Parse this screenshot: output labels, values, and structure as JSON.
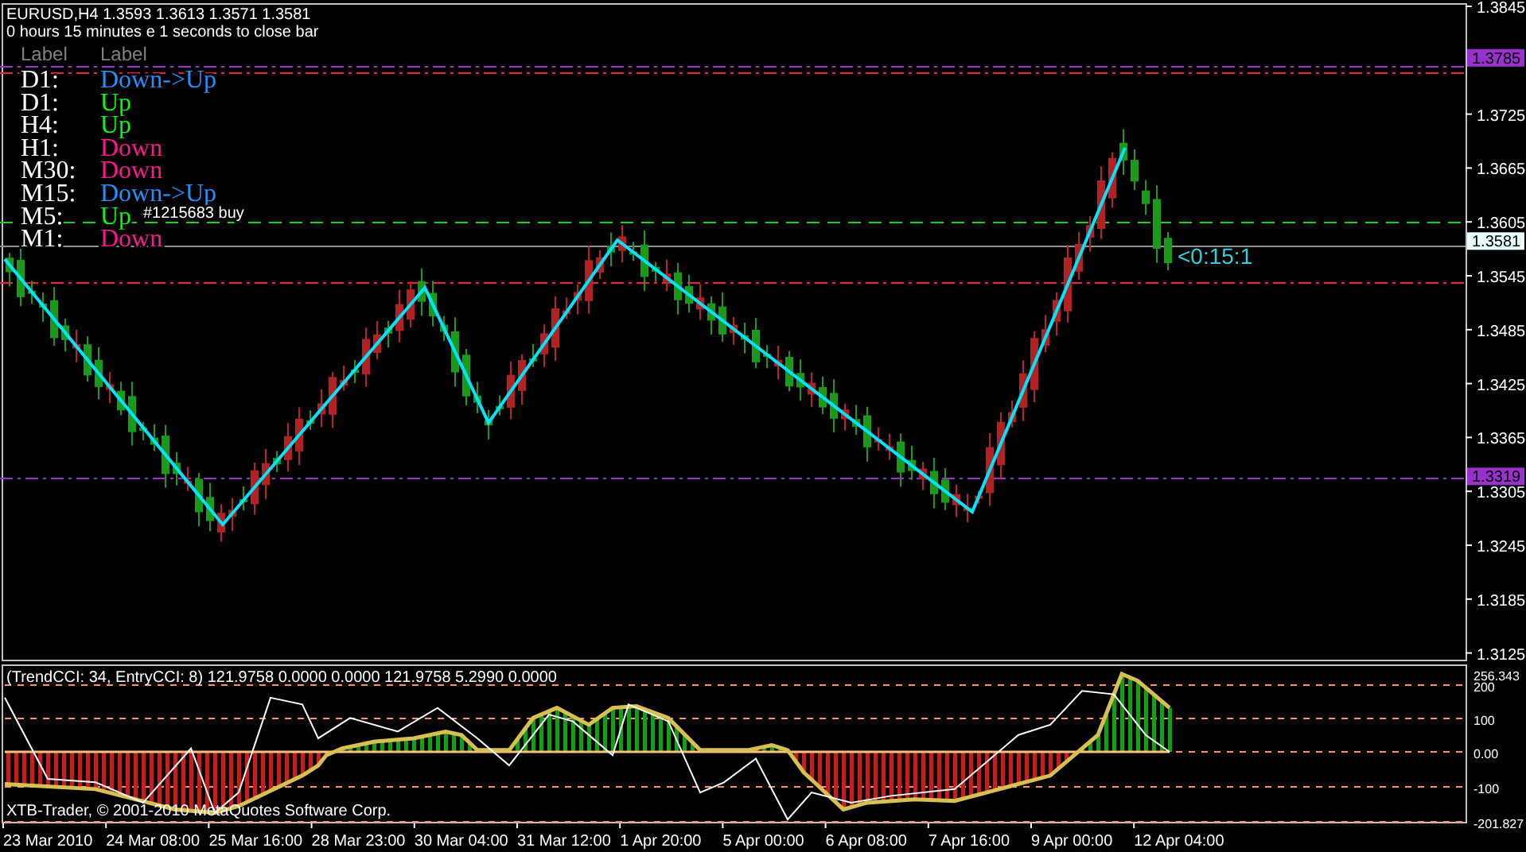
{
  "header": {
    "quote": "EURUSD,H4  1.3593 1.3613 1.3571 1.3581",
    "countdown": "0 hours 15 minutes e 1 seconds to close bar"
  },
  "labels": [
    "Label",
    "Label"
  ],
  "trend_rows": [
    {
      "timeframe": "D1:",
      "trend": "Down->Up",
      "color": "#1e90ff"
    },
    {
      "timeframe": "D1:",
      "trend": "Up",
      "color": "#00ff00"
    },
    {
      "timeframe": "H4:",
      "trend": "Up",
      "color": "#00ff00"
    },
    {
      "timeframe": "H1:",
      "trend": "Down",
      "color": "#ff1493"
    },
    {
      "timeframe": "M30:",
      "trend": "Down",
      "color": "#ff1493"
    },
    {
      "timeframe": "M15:",
      "trend": "Down->Up",
      "color": "#1e90ff"
    },
    {
      "timeframe": "M5:",
      "trend": "Up",
      "color": "#00ff00"
    },
    {
      "timeframe": "M1:",
      "trend": "Down",
      "color": "#ff1493"
    }
  ],
  "order_label": "#1215683 buy",
  "bar_timer": "<0:15:1",
  "price_axis": [
    "1.3845",
    "1.3725",
    "1.3665",
    "1.3605",
    "1.3545",
    "1.3485",
    "1.3425",
    "1.3365",
    "1.3305",
    "1.3245",
    "1.3185",
    "1.3125"
  ],
  "price_markers": [
    {
      "label": "1.3785",
      "color": "#9932cc"
    },
    {
      "label": "1.3581",
      "color": "#e8ffff"
    },
    {
      "label": "1.3319",
      "color": "#9932cc"
    }
  ],
  "indicator": {
    "title": "(TrendCCI: 34, EntryCCI: 8)  121.9758 0.0000 0.0000 121.9758 5.2990 0.0000",
    "axis": [
      "256.343",
      "200",
      "100",
      "0.00",
      "-100",
      "-201.827"
    ]
  },
  "copyright": "XTB-Trader, © 2001-2010 MetaQuotes Software Corp.",
  "time_axis": [
    "23 Mar 2010",
    "24 Mar 08:00",
    "25 Mar 16:00",
    "28 Mar 23:00",
    "30 Mar 04:00",
    "31 Mar 12:00",
    "1 Apr 20:00",
    "5 Apr 00:00",
    "6 Apr 08:00",
    "7 Apr 16:00",
    "9 Apr 00:00",
    "12 Apr 04:00"
  ]
}
